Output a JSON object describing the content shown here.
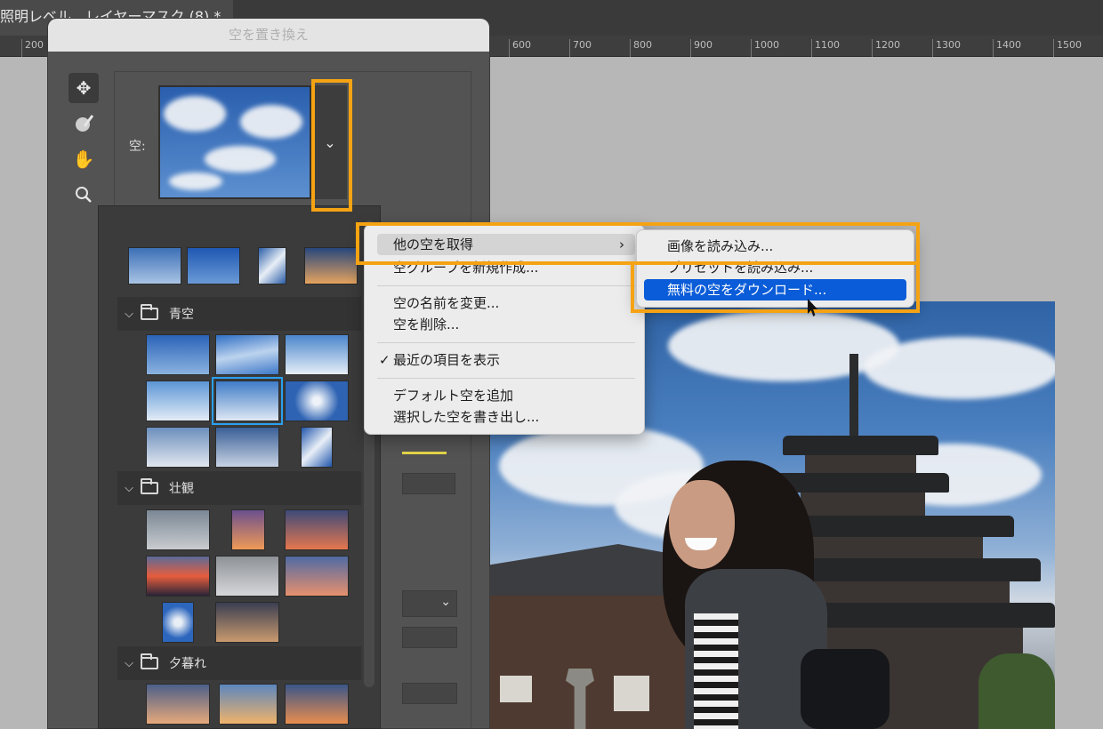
{
  "document": {
    "tab_title": "照明レベル、レイヤーマスク (8) *"
  },
  "ruler": {
    "ticks": [
      "200",
      "600",
      "700",
      "800",
      "900",
      "1000",
      "1100",
      "1200",
      "1300",
      "1400",
      "1500"
    ]
  },
  "dialog": {
    "title": "空を置き換え",
    "sky_label": "空:",
    "tools": [
      "move-icon",
      "sky-brush-icon",
      "hand-icon",
      "zoom-icon"
    ]
  },
  "presets": {
    "folders": [
      {
        "name": "青空",
        "expanded": true
      },
      {
        "name": "壮観",
        "expanded": true
      },
      {
        "name": "夕暮れ",
        "expanded": true
      }
    ]
  },
  "context_menu": {
    "items": [
      {
        "label": "他の空を取得",
        "has_submenu": true,
        "highlighted": true
      },
      {
        "label": "空グループを新規作成..."
      },
      {
        "label": "空の名前を変更..."
      },
      {
        "label": "空を削除..."
      },
      {
        "label": "最近の項目を表示",
        "checked": true
      },
      {
        "label": "デフォルト空を追加"
      },
      {
        "label": "選択した空を書き出し..."
      }
    ],
    "submenu": [
      {
        "label": "画像を読み込み..."
      },
      {
        "label": "プリセットを読み込み..."
      },
      {
        "label": "無料の空をダウンロード...",
        "selected": true
      }
    ]
  },
  "colors": {
    "highlight": "#f5a313",
    "selection": "#0a5cd8",
    "thumb_selected": "#2aa0f0"
  }
}
